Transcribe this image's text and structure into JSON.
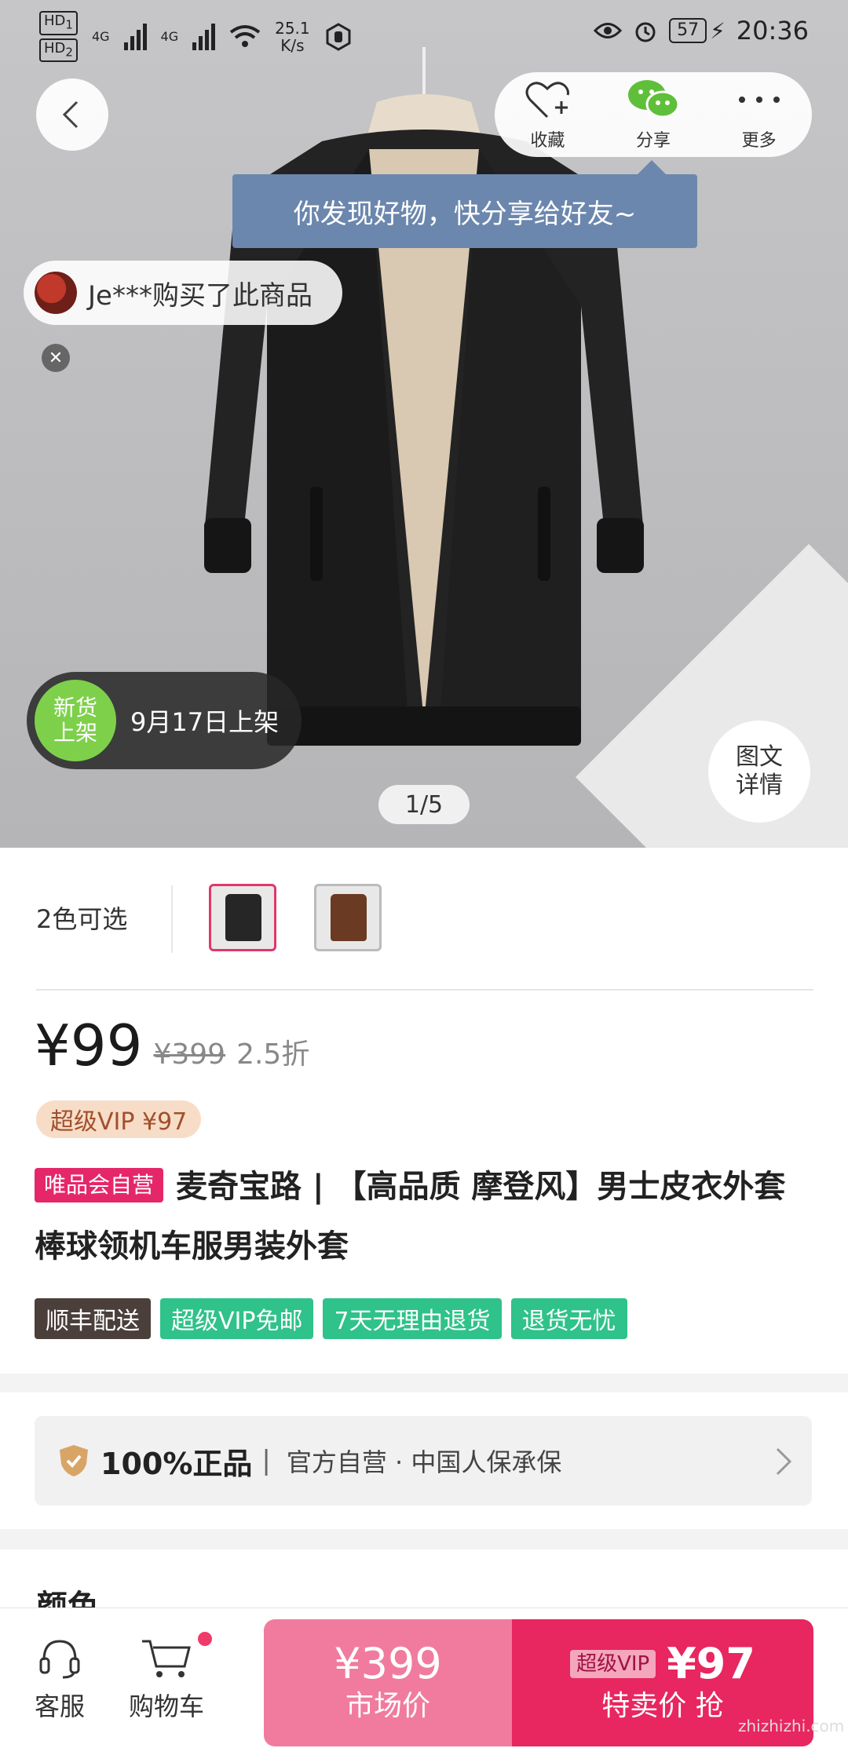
{
  "status_bar": {
    "hd1": "HD",
    "hd1_sub": "1",
    "hd2": "HD",
    "hd2_sub": "2",
    "net1": "4G",
    "net2": "4G",
    "speed": "25.1",
    "speed_unit": "K/s",
    "battery": "57",
    "time": "20:36"
  },
  "top_actions": {
    "favorite_label": "收藏",
    "share_label": "分享",
    "more_label": "更多",
    "share_tooltip": "你发现好物，快分享给好友~"
  },
  "hero": {
    "buyer_text": "Je***购买了此商品",
    "new_badge_line1": "新货",
    "new_badge_line2": "上架",
    "listed_date": "9月17日上架",
    "detail_line1": "图文",
    "detail_line2": "详情",
    "pager": "1/5"
  },
  "product": {
    "colors_label": "2色可选",
    "price": "¥99",
    "original_price": "¥399",
    "discount": "2.5折",
    "super_vip_price": "超级VIP ¥97",
    "self_operated_tag": "唯品会自营",
    "title": "麦奇宝路 | 【高品质 摩登风】男士皮衣外套棒球领机车服男装外套",
    "tags": [
      {
        "label": "顺丰配送",
        "style": "dark"
      },
      {
        "label": "超级VIP免邮",
        "style": "green"
      },
      {
        "label": "7天无理由退货",
        "style": "green"
      },
      {
        "label": "退货无忧",
        "style": "green"
      }
    ]
  },
  "guarantee": {
    "strong": "100%正品",
    "separator": "|",
    "desc": "官方自营 · 中国人保承保"
  },
  "section": {
    "heading": "颜色"
  },
  "bottom_bar": {
    "service_label": "客服",
    "cart_label": "购物车",
    "market_price": "¥399",
    "market_label": "市场价",
    "vip_badge": "超级VIP",
    "special_price": "¥97",
    "special_label": "特卖价 抢"
  },
  "colors": {
    "accent": "#e8265f",
    "green_tag": "#2fc28a",
    "dark_tag": "#4b3f3b"
  },
  "watermark": "zhizhizhi.com"
}
